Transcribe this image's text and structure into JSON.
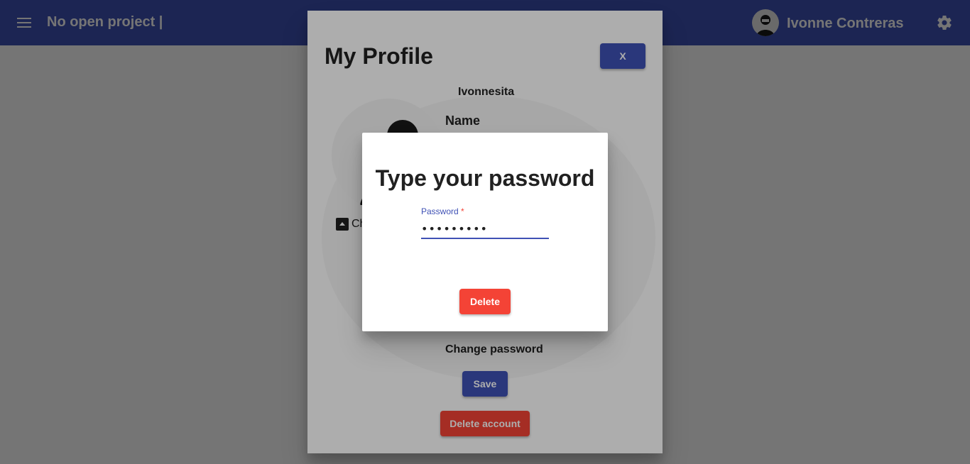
{
  "appbar": {
    "project_title": "No open project |",
    "user_name": "Ivonne Contreras"
  },
  "profile": {
    "title": "My Profile",
    "close_label": "X",
    "username": "Ivonnesita",
    "change_photo_label": "Ch",
    "name_label": "Name",
    "change_password_label": "Change password",
    "save_label": "Save",
    "delete_account_label": "Delete account"
  },
  "password_dialog": {
    "title": "Type your password",
    "field_label": "Password",
    "required_mark": "*",
    "password_value": "•••••••••",
    "delete_label": "Delete"
  },
  "colors": {
    "primary": "#3f51b5",
    "danger": "#f44336"
  }
}
